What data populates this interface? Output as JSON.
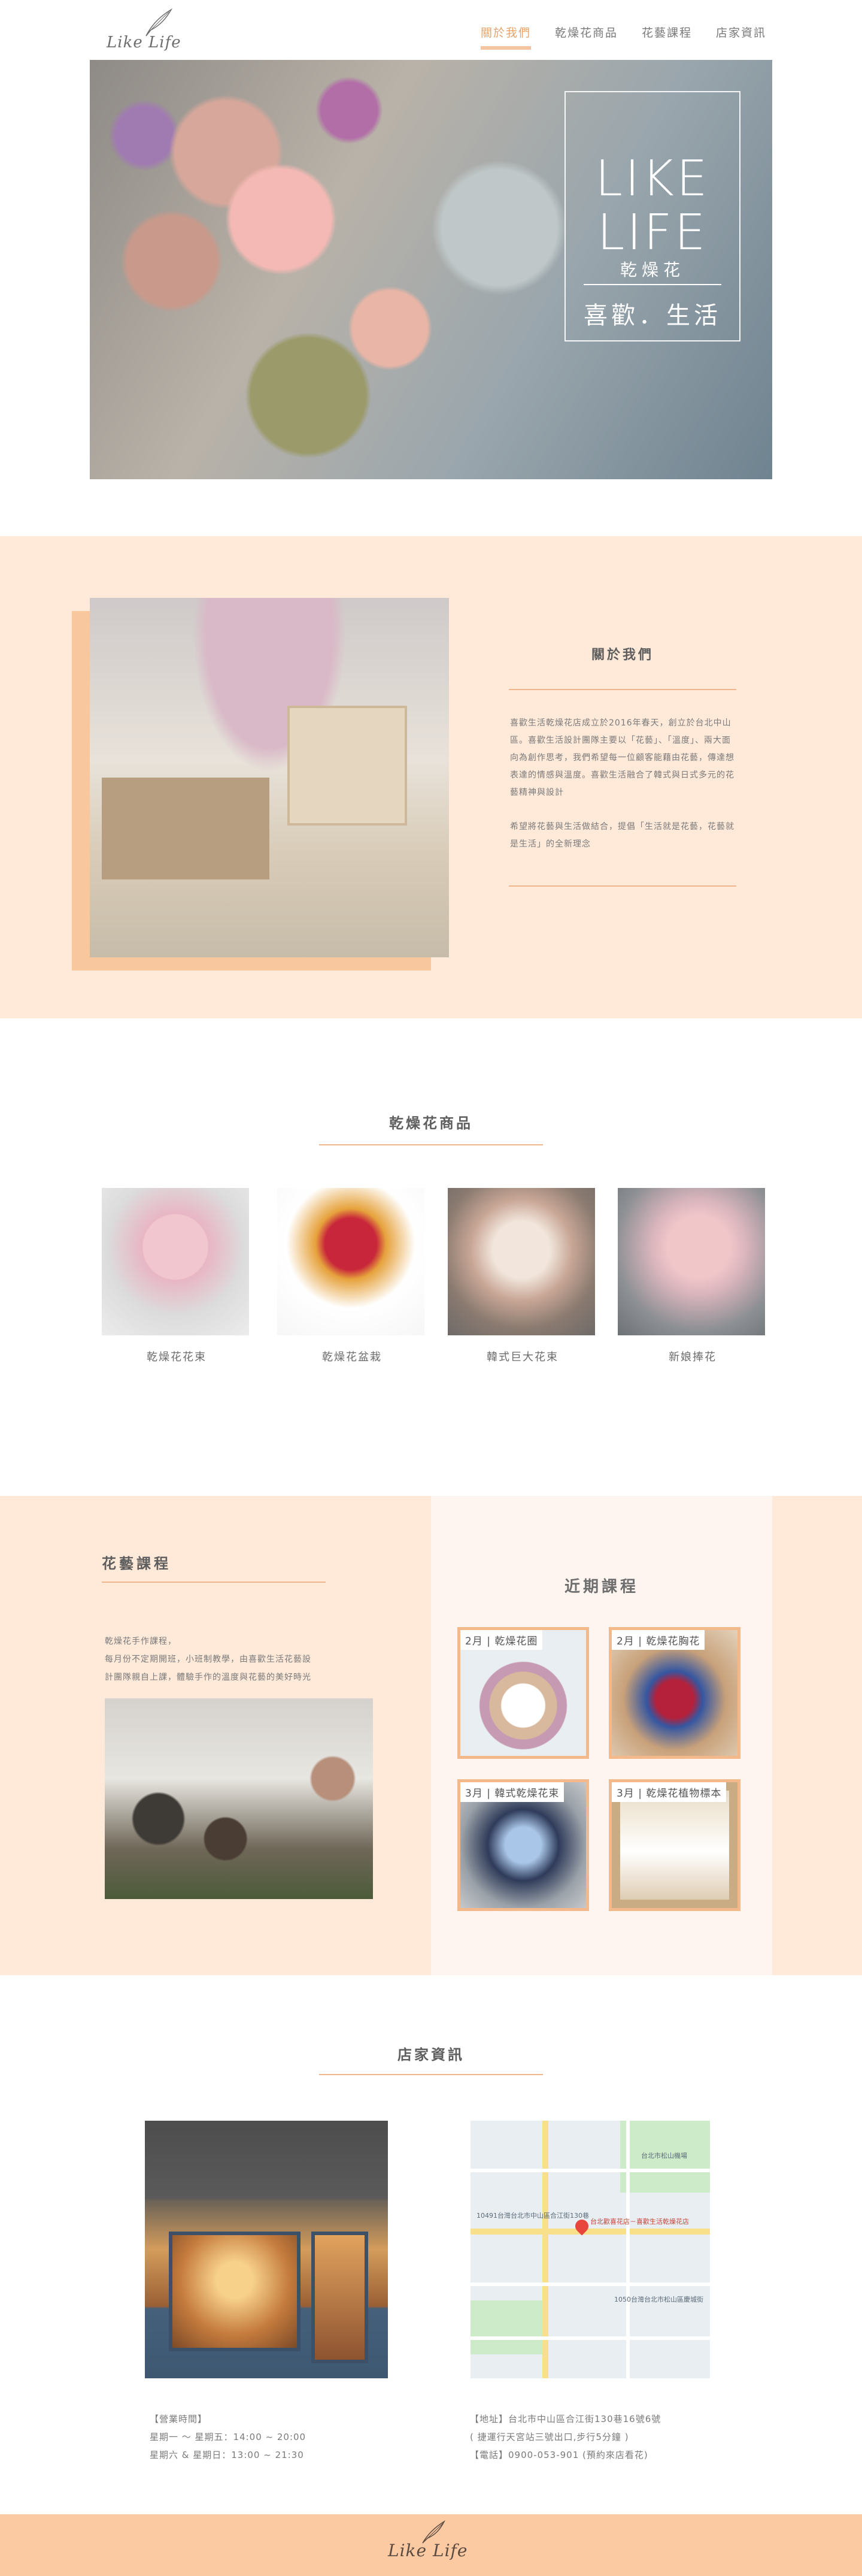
{
  "header": {
    "logo_text": "Like Life",
    "nav": [
      {
        "label": "關於我們",
        "active": true
      },
      {
        "label": "乾燥花商品",
        "active": false
      },
      {
        "label": "花藝課程",
        "active": false
      },
      {
        "label": "店家資訊",
        "active": false
      }
    ]
  },
  "hero": {
    "title_line1": "LIKE",
    "title_line2": "LIFE",
    "subtitle": "乾燥花",
    "slogan": "喜歡．生活"
  },
  "about": {
    "heading": "關於我們",
    "paragraph1": "喜歡生活乾燥花店成立於2016年春天，創立於台北中山區。喜歡生活設計團隊主要以「花藝」、「溫度」、兩大面向為創作思考，我們希望每一位顧客能藉由花藝，傳達想表達的情感與溫度。喜歡生活融合了韓式與日式多元的花藝精神與設計",
    "paragraph2": "希望將花藝與生活做結合，提倡「生活就是花藝，花藝就是生活」的全新理念"
  },
  "products": {
    "heading": "乾燥花商品",
    "items": [
      {
        "label": "乾燥花花束",
        "color": "#f2c6cf"
      },
      {
        "label": "乾燥花盆栽",
        "color": "#c8263a"
      },
      {
        "label": "韓式巨大花束",
        "color": "#c8a696"
      },
      {
        "label": "新娘捧花",
        "color": "#f0c6c9"
      }
    ]
  },
  "courses": {
    "heading": "花藝課程",
    "text_line1": "乾燥花手作課程，",
    "text_line2": "每月份不定期開班，小班制教學，由喜歡生活花藝設",
    "text_line3": "計團隊親自上課，體驗手作的溫度與花藝的美好時光",
    "upcoming_heading": "近期課程",
    "cards": [
      {
        "label": "2月 | 乾燥花圈"
      },
      {
        "label": "2月 | 乾燥花胸花"
      },
      {
        "label": "3月 | 韓式乾燥花束"
      },
      {
        "label": "3月 | 乾燥花植物標本"
      }
    ]
  },
  "store": {
    "heading": "店家資訊",
    "hours_title": "【營業時間】",
    "hours_weekday": "星期一 ～ 星期五：14:00 ~ 20:00",
    "hours_weekend": "星期六 & 星期日：13:00 ~ 21:30",
    "address": "【地址】台北市中山區合江街130巷16號6號",
    "transit": "( 捷運行天宮站三號出口,步行5分鐘 )",
    "phone": "【電話】0900-053-901 (預約來店看花)",
    "map_labels": {
      "label1": "10491台灣台北市中山區合江街130巷",
      "label2": "台北歡喜花店－喜歡生活乾燥花店",
      "label3": "台北市松山機場",
      "label4": "1050台灣台北市松山區慶城街"
    }
  },
  "footer": {
    "logo_text": "Like Life"
  }
}
